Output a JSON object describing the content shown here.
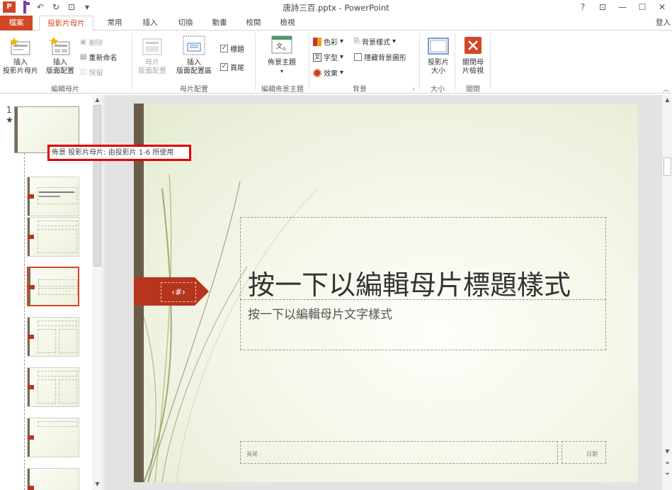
{
  "titlebar": {
    "app_badge": "P",
    "document_title": "唐詩三百.pptx - PowerPoint",
    "help": "?",
    "restore_ribbon": "⊡",
    "minimize": "—",
    "maximize": "☐",
    "close": "✕"
  },
  "tabs": {
    "file": "檔案",
    "slide_master": "投影片母片",
    "home": "常用",
    "insert": "插入",
    "transitions": "切換",
    "animations": "動畫",
    "review": "校閱",
    "view": "檢視",
    "sign_in": "登入"
  },
  "ribbon": {
    "insert_slide_master": "插入\n投影片母片",
    "insert_layout": "插入\n版面配置",
    "delete": "刪除",
    "rename": "重新命名",
    "preserve": "保留",
    "group_edit_master": "編輯母片",
    "master_layout": "母片\n版面配置",
    "insert_placeholder": "插入\n版面配置區",
    "title_checkbox": "標題",
    "footers_checkbox": "頁尾",
    "group_master_layout": "母片配置",
    "themes": "佈景主題",
    "group_edit_theme": "編輯佈景主題",
    "colors": "色彩",
    "fonts": "字型",
    "effects": "效果",
    "background_styles": "背景樣式",
    "hide_background_graphics": "隱藏背景圖形",
    "group_background": "背景",
    "slide_size": "投影片\n大小",
    "group_size": "大小",
    "close_master_view": "關閉母\n片檢視",
    "group_close": "關閉"
  },
  "thumbnails": {
    "slide_number": "1",
    "master_star": "★",
    "tooltip": "佈景 投影片母片: 由投影片 1-6 所使用",
    "selected_index": 3
  },
  "slide": {
    "slide_number_placeholder": "‹#›",
    "title_placeholder": "按一下以編輯母片標題樣式",
    "body_placeholder": "按一下以編輯母片文字樣式",
    "footer_placeholder": "頁尾",
    "date_placeholder": "日期"
  },
  "colors": {
    "accent": "#d24726",
    "slide_bar": "#6b5c48",
    "flag": "#b5351d",
    "tooltip_border": "#e00000"
  }
}
